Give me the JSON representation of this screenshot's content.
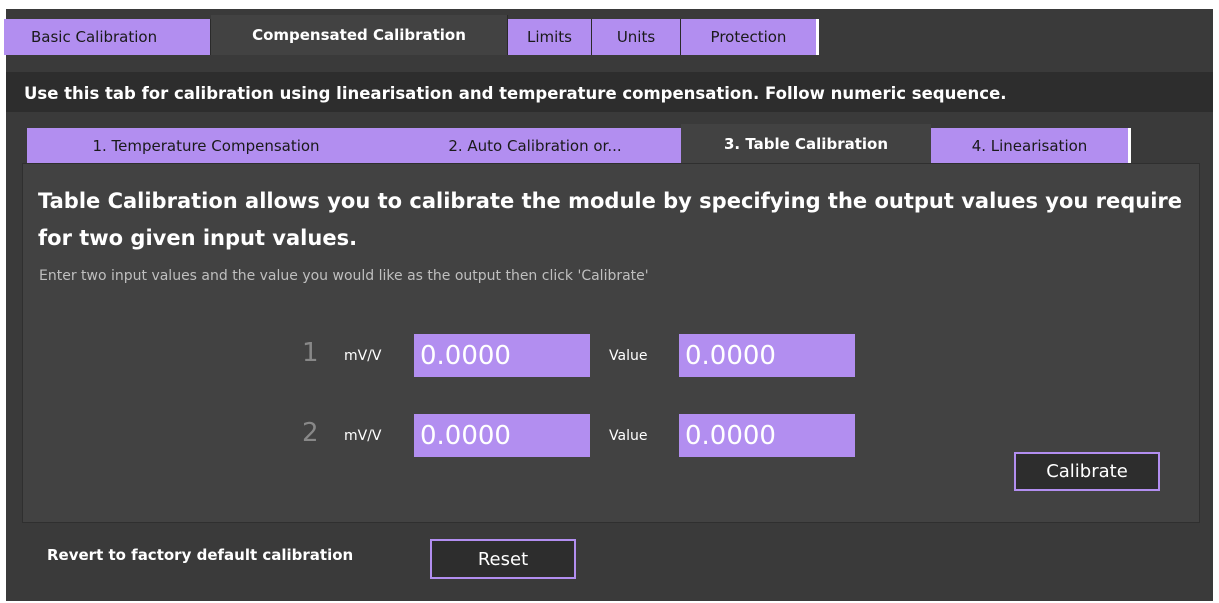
{
  "top_tabs": [
    {
      "label": "Basic Calibration"
    },
    {
      "label": "Compensated Calibration"
    },
    {
      "label": "Limits"
    },
    {
      "label": "Units"
    },
    {
      "label": "Protection"
    }
  ],
  "instructions": "Use this tab for calibration using linearisation and temperature compensation. Follow numeric sequence.",
  "sub_tabs": [
    {
      "label": "1. Temperature Compensation"
    },
    {
      "label": "2. Auto Calibration or..."
    },
    {
      "label": "3. Table Calibration"
    },
    {
      "label": "4. Linearisation"
    }
  ],
  "panel": {
    "heading": "Table Calibration allows you to calibrate the module by specifying the output values you require for two given input values.",
    "hint": "Enter two input values and the value you would like as the output then click 'Calibrate'",
    "rows": [
      {
        "number": "1",
        "unit": "mV/V",
        "input": "0.0000",
        "value_label": "Value",
        "value": "0.0000"
      },
      {
        "number": "2",
        "unit": "mV/V",
        "input": "0.0000",
        "value_label": "Value",
        "value": "0.0000"
      }
    ],
    "calibrate_label": "Calibrate"
  },
  "footer": {
    "revert_label": "Revert to factory default calibration",
    "reset_label": "Reset"
  },
  "colors": {
    "accent": "#b28ef0",
    "background": "#3a3a3a",
    "panel": "#424242"
  }
}
